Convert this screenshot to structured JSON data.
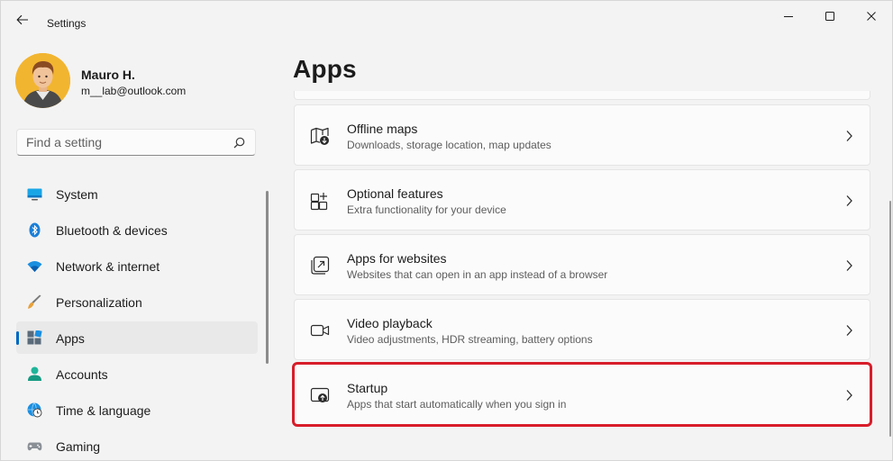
{
  "window": {
    "title": "Settings"
  },
  "profile": {
    "name": "Mauro H.",
    "email": "m__lab@outlook.com"
  },
  "search": {
    "placeholder": "Find a setting"
  },
  "sidebar": {
    "items": [
      {
        "label": "System",
        "icon": "monitor-icon",
        "active": false
      },
      {
        "label": "Bluetooth & devices",
        "icon": "bluetooth-icon",
        "active": false
      },
      {
        "label": "Network & internet",
        "icon": "wifi-icon",
        "active": false
      },
      {
        "label": "Personalization",
        "icon": "brush-icon",
        "active": false
      },
      {
        "label": "Apps",
        "icon": "apps-icon",
        "active": true
      },
      {
        "label": "Accounts",
        "icon": "person-icon",
        "active": false
      },
      {
        "label": "Time & language",
        "icon": "globe-clock-icon",
        "active": false
      },
      {
        "label": "Gaming",
        "icon": "gamepad-icon",
        "active": false
      }
    ]
  },
  "main": {
    "title": "Apps",
    "cards": [
      {
        "title": "Offline maps",
        "description": "Downloads, storage location, map updates",
        "icon": "map-download-icon"
      },
      {
        "title": "Optional features",
        "description": "Extra functionality for your device",
        "icon": "optional-features-icon"
      },
      {
        "title": "Apps for websites",
        "description": "Websites that can open in an app instead of a browser",
        "icon": "app-link-icon"
      },
      {
        "title": "Video playback",
        "description": "Video adjustments, HDR streaming, battery options",
        "icon": "video-camera-icon"
      },
      {
        "title": "Startup",
        "description": "Apps that start automatically when you sign in",
        "icon": "startup-icon",
        "highlighted": true
      }
    ]
  },
  "colors": {
    "accent": "#0067c0",
    "highlight_border": "#d81d2a",
    "background": "#f3f3f3",
    "card": "#fbfbfb"
  }
}
